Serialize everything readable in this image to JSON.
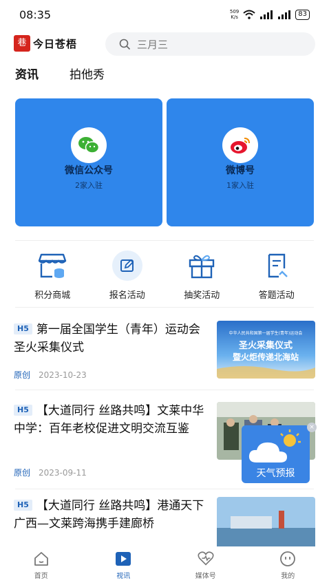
{
  "status": {
    "time": "08:35",
    "net_speed_top": "509",
    "net_speed_bottom": "K/s",
    "battery": "83"
  },
  "header": {
    "logo_mark": "巷",
    "app_name": "今日苍梧",
    "search_placeholder": "三月三"
  },
  "tabs": [
    {
      "label": "资讯"
    },
    {
      "label": "拍他秀"
    }
  ],
  "cards": [
    {
      "title": "微信公众号",
      "subtitle": "2家入驻",
      "icon": "wechat-icon"
    },
    {
      "title": "微博号",
      "subtitle": "1家入驻",
      "icon": "weibo-icon"
    }
  ],
  "shortcuts": [
    {
      "label": "积分商城",
      "icon": "store-icon"
    },
    {
      "label": "报名活动",
      "icon": "edit-icon"
    },
    {
      "label": "抽奖活动",
      "icon": "gift-icon"
    },
    {
      "label": "答题活动",
      "icon": "quiz-icon"
    }
  ],
  "news": [
    {
      "badge": "H5",
      "title": "第一届全国学生（青年）运动会圣火采集仪式",
      "source": "原创",
      "date": "2023-10-23",
      "thumb_line1": "中华人民共和国第一届学生(青年)运动会",
      "thumb_line2": "圣火采集仪式",
      "thumb_line3": "暨火炬传递北海站"
    },
    {
      "badge": "H5",
      "title": "【大道同行 丝路共鸣】文莱中华中学：百年老校促进文明交流互鉴",
      "source": "原创",
      "date": "2023-09-11"
    },
    {
      "badge": "H5",
      "title": "【大道同行 丝路共鸣】港通天下 广西—文莱跨海携手建廊桥"
    }
  ],
  "weather_widget": {
    "label": "天气预报",
    "close": "×"
  },
  "bottom_nav": [
    {
      "label": "首页",
      "icon": "home-icon",
      "active": false
    },
    {
      "label": "视讯",
      "icon": "video-icon",
      "active": true
    },
    {
      "label": "媒体号",
      "icon": "heart-icon",
      "active": false
    },
    {
      "label": "我的",
      "icon": "profile-icon",
      "active": false
    }
  ],
  "colors": {
    "brand_blue": "#2f86eb",
    "accent": "#1e62b7",
    "logo_red": "#d5251d"
  }
}
